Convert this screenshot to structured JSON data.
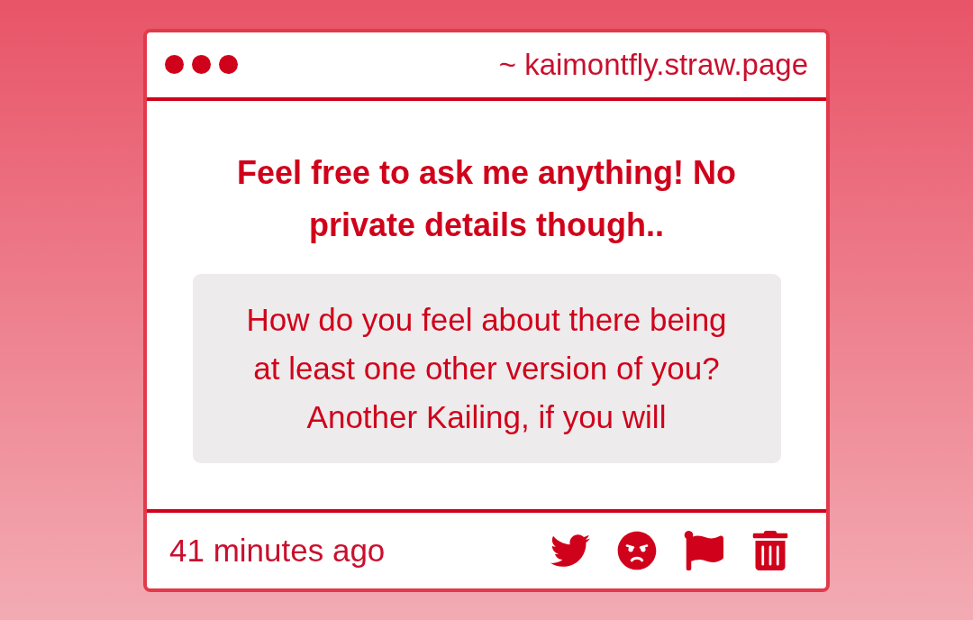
{
  "window": {
    "url": "~ kaimontfly.straw.page"
  },
  "prompt": "Feel free to ask me anything! No private details though..",
  "question": "How do you feel about there being at least one other version of you? Another Kailing, if you will",
  "footer": {
    "time": "41 minutes ago",
    "actions": [
      {
        "kind": "twitter"
      },
      {
        "kind": "angry"
      },
      {
        "kind": "flag"
      },
      {
        "kind": "delete"
      }
    ]
  }
}
